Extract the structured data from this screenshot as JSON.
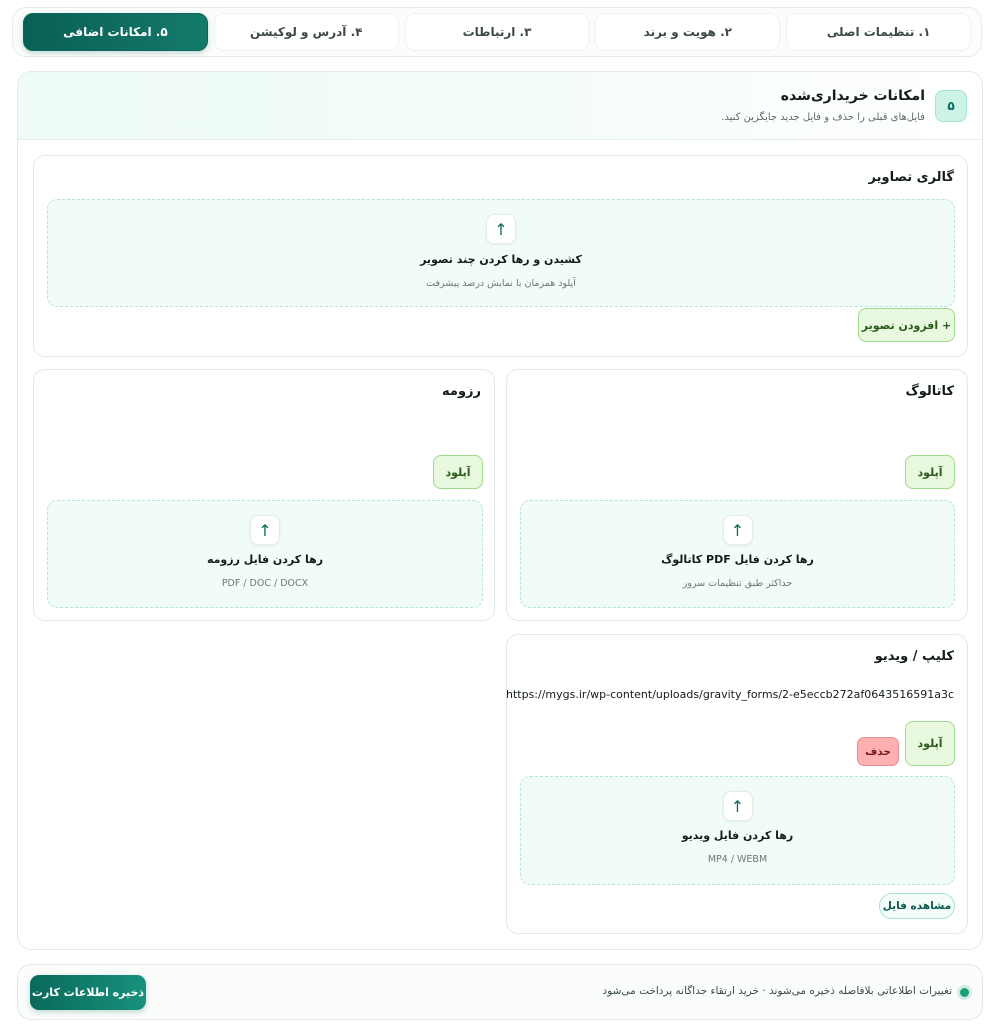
{
  "tabs": [
    {
      "label": "۱. تنظیمات اصلی"
    },
    {
      "label": "۲. هویت و برند"
    },
    {
      "label": "۳. ارتباطات"
    },
    {
      "label": "۴. آدرس و لوکیشن"
    },
    {
      "label": "۵. امکانات اضافی"
    }
  ],
  "active_tab_index": 4,
  "panel": {
    "step": "۵",
    "title": "امکانات خریداری‌شده",
    "subtitle": "فایل‌های قبلی را حذف و فایل جدید جایگزین کنید."
  },
  "gallery": {
    "title": "گالری تصاویر",
    "drop_title": "کشیدن و رها کردن چند تصویر",
    "drop_hint": "آپلود همزمان با نمایش درصد پیشرفت",
    "add_button": "+ افزودن تصویر"
  },
  "catalog": {
    "title": "کاتالوگ",
    "upload_button": "آپلود",
    "drop_title": "رها کردن فایل PDF کاتالوگ",
    "drop_hint": "حداکثر طبق تنظیمات سرور"
  },
  "resume": {
    "title": "رزومه",
    "upload_button": "آپلود",
    "drop_title": "رها کردن فایل رزومه",
    "drop_hint": "PDF / DOC / DOCX"
  },
  "video": {
    "title": "کلیپ / ویدیو",
    "file_url": "https://mygs.ir/wp-content/uploads/gravity_forms/2-e5eccb272af0643516591a3c",
    "upload_button": "آپلود",
    "delete_button": "حذف",
    "drop_title": "رها کردن فایل ویدیو",
    "drop_hint": "MP4 / WEBM",
    "view_button": "مشاهده فایل"
  },
  "footer": {
    "status_text": "تغییرات اطلاعاتی بلافاصله ذخیره می‌شوند · خرید ارتقاء جداگانه پرداخت می‌شود",
    "save_button": "ذخیره اطلاعات کارت"
  },
  "icons": {
    "upload": "↑"
  },
  "colors": {
    "accent": "#0b6a5d",
    "upload_button_bg": "#e9f9df",
    "delete_button_bg": "#ffb1b1",
    "drop_zone_bg": "#f1fcf8"
  }
}
